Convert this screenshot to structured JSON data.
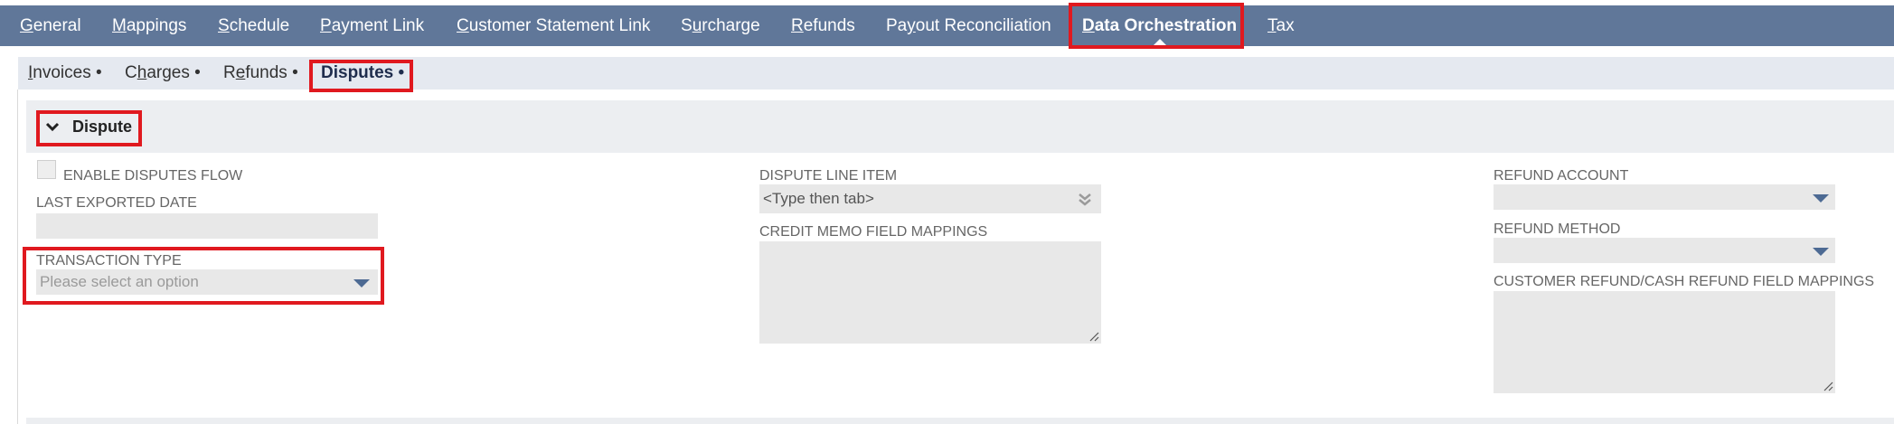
{
  "top_tabs": [
    {
      "u": "G",
      "rest": "eneral"
    },
    {
      "u": "M",
      "rest": "appings"
    },
    {
      "u": "S",
      "rest": "chedule"
    },
    {
      "u": "P",
      "rest": "ayment Link"
    },
    {
      "u": "C",
      "rest": "ustomer Statement Link"
    },
    {
      "pre": "S",
      "u": "u",
      "rest": "rcharge"
    },
    {
      "u": "R",
      "rest": "efunds"
    },
    {
      "pre": "Pa",
      "u": "y",
      "rest": "out Reconciliation"
    },
    {
      "u": "D",
      "rest": "ata Orchestration"
    },
    {
      "u": "T",
      "rest": "ax"
    }
  ],
  "sub_tabs": [
    {
      "u": "I",
      "rest": "nvoices",
      "dot": "•"
    },
    {
      "pre": "C",
      "u": "h",
      "rest": "arges",
      "dot": "•"
    },
    {
      "pre": "R",
      "u": "e",
      "rest": "funds",
      "dot": "•"
    },
    {
      "label": "Disputes",
      "dot": "•"
    }
  ],
  "section": {
    "title": "Dispute"
  },
  "left": {
    "enable_label": "ENABLE DISPUTES FLOW",
    "last_exported_label": "LAST EXPORTED DATE",
    "last_exported_value": "",
    "transaction_type_label": "TRANSACTION TYPE",
    "transaction_type_placeholder": "Please select an option"
  },
  "middle": {
    "dispute_line_item_label": "DISPUTE LINE ITEM",
    "dispute_line_item_value": "<Type then tab>",
    "credit_memo_label": "CREDIT MEMO FIELD MAPPINGS",
    "credit_memo_value": ""
  },
  "right": {
    "refund_account_label": "REFUND ACCOUNT",
    "refund_method_label": "REFUND METHOD",
    "customer_refund_label": "CUSTOMER REFUND/CASH REFUND FIELD MAPPINGS",
    "customer_refund_value": ""
  },
  "colors": {
    "topbar": "#607799",
    "subbar": "#e5e9f0",
    "highlight": "#e0191f",
    "dropdown_arrow": "#4d6a93"
  }
}
